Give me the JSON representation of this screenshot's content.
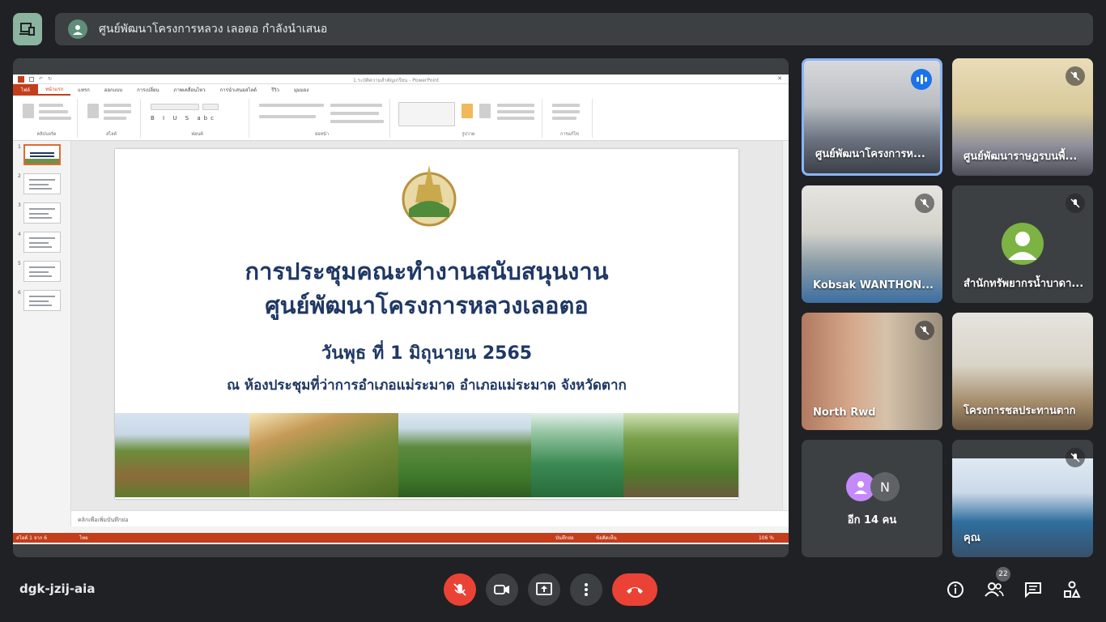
{
  "top": {
    "presenting_text": "ศูนย์พัฒนาโครงการหลวง เลอตอ กำลังนำเสนอ"
  },
  "powerpoint": {
    "window_title": "1.ระบัติความสำคัญเกรียน - PowerPoint",
    "tabs": [
      "ไฟล์",
      "หน้าแรก",
      "แทรก",
      "ออกแบบ",
      "การเปลี่ยน",
      "ภาพเคลื่อนไหว",
      "การนำเสนอสไลด์",
      "รีวิว",
      "มุมมอง"
    ],
    "ribbon_groups": [
      "คลิปบอร์ด",
      "สไลด์",
      "ฟอนต์",
      "ย่อหน้า",
      "รูปวาด",
      "การแก้ไข"
    ],
    "slide_numbers": [
      "1",
      "2",
      "3",
      "4",
      "5",
      "6"
    ],
    "notes_placeholder": "คลิกเพื่อเพิ่มบันทึกย่อ",
    "status_left": "สไลด์ 1 จาก 6",
    "status_lang": "ไทย",
    "status_notes": "บันทึกย่อ",
    "status_comments": "ข้อคิดเห็น",
    "zoom": "106 %"
  },
  "slide": {
    "logo_text": "โครงการหลวง",
    "title_line1": "การประชุมคณะทำงานสนับสนุนงาน",
    "title_line2": "ศูนย์พัฒนาโครงการหลวงเลอตอ",
    "date": "วันพุธ  ที่   1   มิถุนายน   2565",
    "place": "ณ ห้องประชุมที่ว่าการอำเภอแม่ระมาด  อำเภอแม่ระมาด จังหวัดตาก"
  },
  "participants": [
    {
      "name": "ศูนย์พัฒนาโครงการห...",
      "speaking": true
    },
    {
      "name": "ศูนย์พัฒนาราษฎรบนพื้...",
      "muted": true
    },
    {
      "name": "Kobsak WANTHON...",
      "muted": true
    },
    {
      "name": "สำนักทรัพยากรน้ำบาดา...",
      "muted": true
    },
    {
      "name": "North Rwd",
      "muted": true
    },
    {
      "name": "โครงการชลประทานตาก",
      "muted": false
    },
    {
      "name": "อีก 14 คน",
      "avatar_letter": "N"
    },
    {
      "name": "คุณ",
      "muted": true
    }
  ],
  "bottom": {
    "meeting_code": "dgk-jzij-aia",
    "people_count": "22"
  },
  "colors": {
    "bg": "#202124",
    "end_call": "#ea4335",
    "ppt_accent": "#c43e1c",
    "slide_title": "#1f3864"
  }
}
